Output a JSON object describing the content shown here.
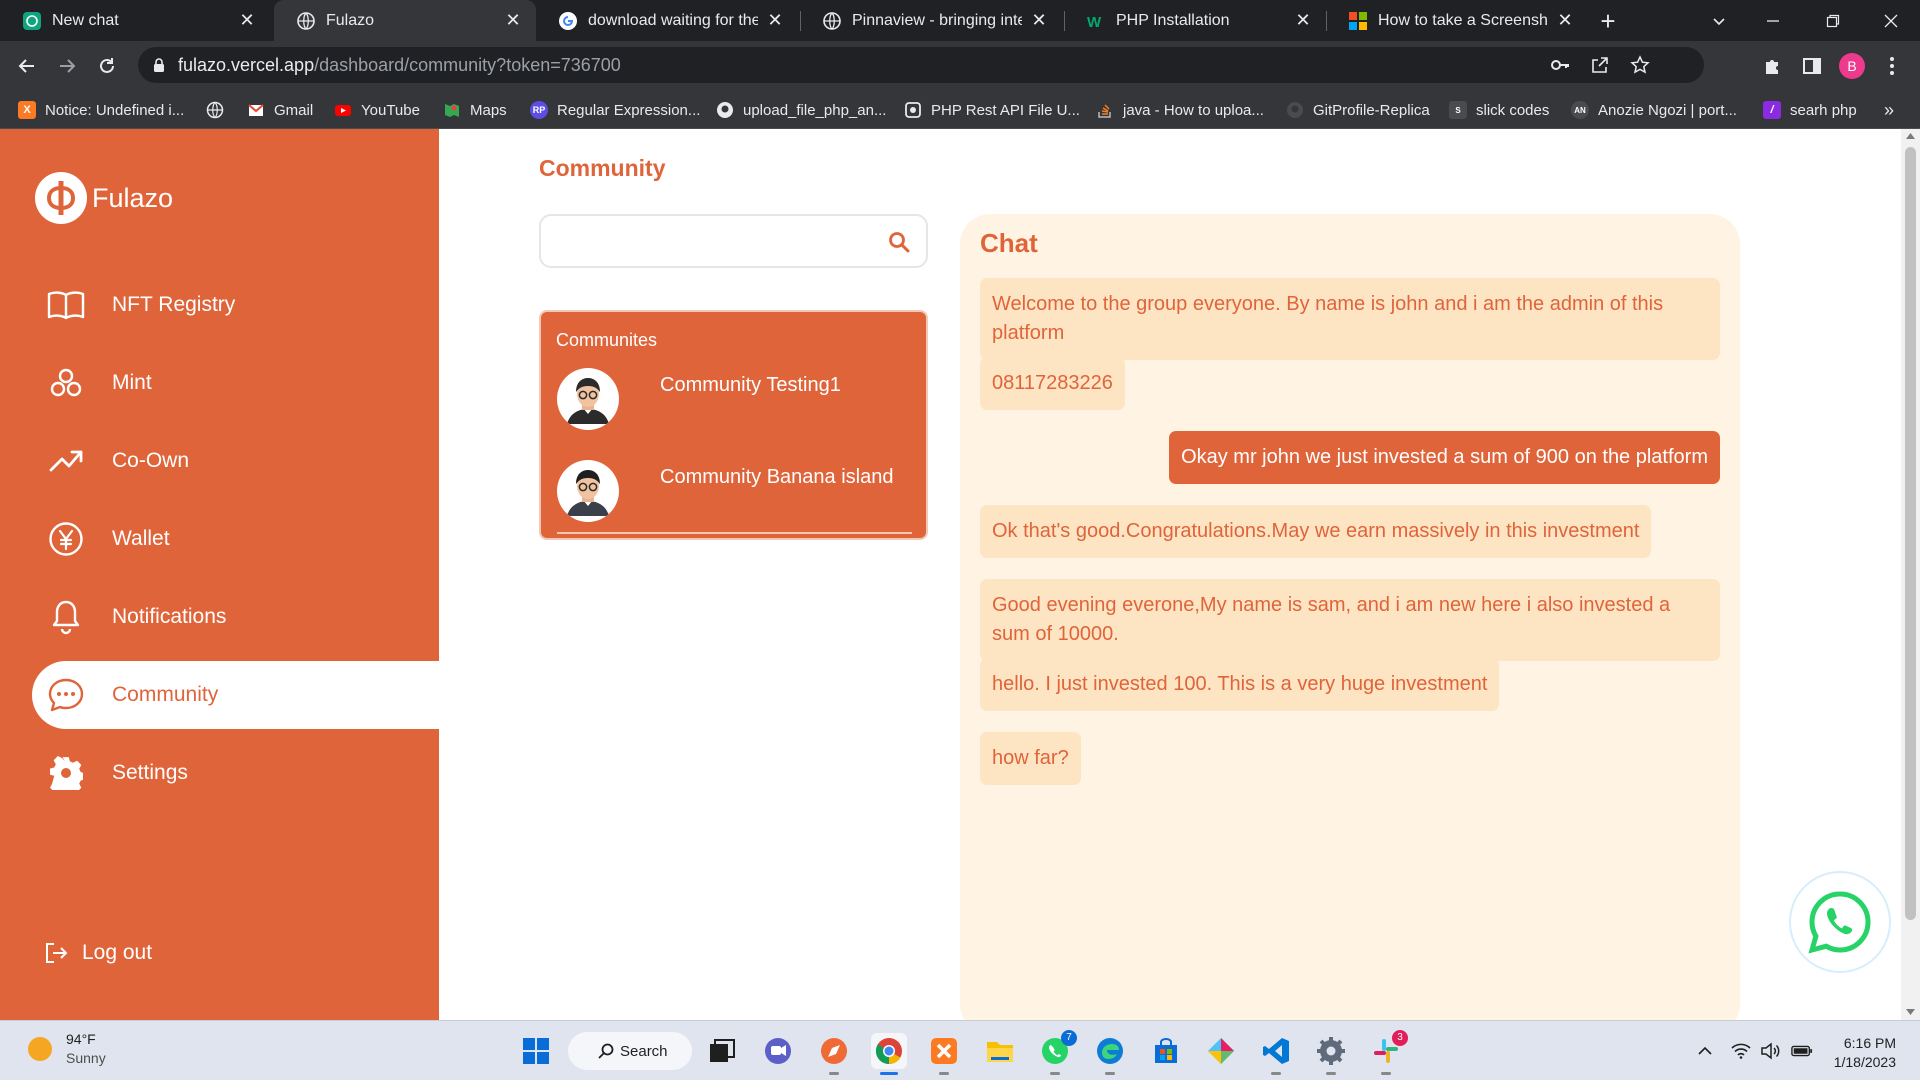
{
  "browser": {
    "tabs": [
      {
        "title": "New chat",
        "icon": "openai-icon",
        "active": false
      },
      {
        "title": "Fulazo",
        "icon": "globe-icon",
        "active": true
      },
      {
        "title": "download waiting for the ca",
        "icon": "google-icon",
        "active": false
      },
      {
        "title": "Pinnaview - bringing intern",
        "icon": "globe-icon",
        "active": false
      },
      {
        "title": "PHP Installation",
        "icon": "w3schools-icon",
        "active": false
      },
      {
        "title": "How to take a Screenshot i",
        "icon": "microsoft-icon",
        "active": false
      }
    ],
    "address": {
      "host": "fulazo.vercel.app",
      "path": "/dashboard/community?token=736700"
    },
    "profile_initial": "B",
    "bookmarks": [
      {
        "label": "Notice: Undefined i...",
        "icon": "xampp-icon"
      },
      {
        "label": "",
        "icon": "globe-icon"
      },
      {
        "label": "Gmail",
        "icon": "gmail-icon"
      },
      {
        "label": "YouTube",
        "icon": "youtube-icon"
      },
      {
        "label": "Maps",
        "icon": "maps-icon"
      },
      {
        "label": "Regular Expression...",
        "icon": "rp-icon"
      },
      {
        "label": "upload_file_php_an...",
        "icon": "github-icon"
      },
      {
        "label": "PHP Rest API File U...",
        "icon": "page-icon"
      },
      {
        "label": "java - How to uploa...",
        "icon": "stackoverflow-icon"
      },
      {
        "label": "GitProfile-Replica",
        "icon": "github-icon"
      },
      {
        "label": "slick codes",
        "icon": "slick-icon"
      },
      {
        "label": "Anozie Ngozi | port...",
        "icon": "portfolio-icon"
      },
      {
        "label": "searh php",
        "icon": "php-icon"
      }
    ],
    "bookmarks_overflow": "»"
  },
  "app": {
    "brand": "Fulazo",
    "nav": [
      {
        "label": "NFT Registry",
        "icon": "book-icon"
      },
      {
        "label": "Mint",
        "icon": "mint-icon"
      },
      {
        "label": "Co-Own",
        "icon": "trending-icon"
      },
      {
        "label": "Wallet",
        "icon": "yen-coin-icon"
      },
      {
        "label": "Notifications",
        "icon": "bell-icon"
      },
      {
        "label": "Community",
        "icon": "chat-bubble-icon",
        "active": true
      },
      {
        "label": "Settings",
        "icon": "gear-icon"
      }
    ],
    "logout_label": "Log out",
    "accent_color": "#e0643a"
  },
  "community": {
    "page_title": "Community",
    "search": {
      "value": "",
      "placeholder": ""
    },
    "list_title": "Communites",
    "items": [
      {
        "name": "Community Testing1"
      },
      {
        "name": "Community Banana island"
      }
    ]
  },
  "chat": {
    "title": "Chat",
    "messages": [
      {
        "text": "Welcome to the group everyone. By name is john and i am the admin of this platform",
        "direction": "in"
      },
      {
        "text": "08117283226",
        "direction": "in"
      },
      {
        "text": "Okay mr john we just invested a sum of 900 on the platform",
        "direction": "out"
      },
      {
        "text": "Ok that's good.Congratulations.May we earn massively in this investment",
        "direction": "in"
      },
      {
        "text": "Good evening everone,My name is sam, and i am new here i also invested a sum of 10000.",
        "direction": "in"
      },
      {
        "text": "hello. I just invested 100. This is a very huge investment",
        "direction": "in"
      },
      {
        "text": "how far?",
        "direction": "in"
      }
    ]
  },
  "taskbar": {
    "weather": {
      "temp": "94°F",
      "condition": "Sunny"
    },
    "search_label": "Search",
    "badges": {
      "whatsapp": "7",
      "slack": "3"
    },
    "time": "6:16 PM",
    "date": "1/18/2023"
  }
}
